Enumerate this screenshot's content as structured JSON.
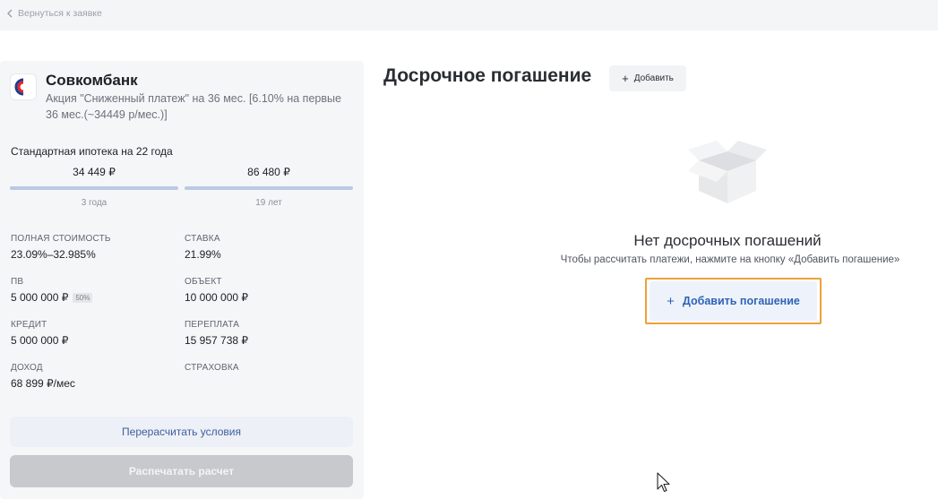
{
  "nav": {
    "back_label": "Вернуться к заявке"
  },
  "bank": {
    "name": "Совкомбанк",
    "promo": "Акция \"Сниженный платеж\" на 36 мес. [6.10% на первые 36 мес.(~34449 р/мес.)]",
    "brand_colors": {
      "red": "#e2242a",
      "blue": "#1f3b8c"
    }
  },
  "mortgage": {
    "title": "Стандартная ипотека на 22 года",
    "segments": [
      {
        "amount": "34 449 ₽",
        "duration": "3 года"
      },
      {
        "amount": "86 480 ₽",
        "duration": "19 лет"
      }
    ]
  },
  "details": {
    "full_cost": {
      "label": "ПОЛНАЯ СТОИМОСТЬ",
      "value": "23.09%–32.985%"
    },
    "rate": {
      "label": "СТАВКА",
      "value": "21.99%"
    },
    "down_payment": {
      "label": "ПВ",
      "value": "5 000 000 ₽",
      "badge": "50%"
    },
    "object": {
      "label": "ОБЪЕКТ",
      "value": "10 000 000 ₽"
    },
    "credit": {
      "label": "КРЕДИТ",
      "value": "5 000 000 ₽"
    },
    "overpayment": {
      "label": "ПЕРЕПЛАТА",
      "value": "15 957 738 ₽"
    },
    "income": {
      "label": "ДОХОД",
      "value": "68 899 ₽/мес"
    },
    "insurance": {
      "label": "СТРАХОВКА"
    }
  },
  "actions": {
    "recalc_label": "Перерасчитать условия",
    "print_label": "Распечатать расчет"
  },
  "early": {
    "title": "Досрочное погашение",
    "add_label": "Добавить",
    "empty_title": "Нет досрочных погашений",
    "empty_desc": "Чтобы рассчитать платежи, нажмите на кнопку «Добавить погашение»",
    "add_payment_label": "Добавить погашение",
    "highlight_color": "#eea039"
  },
  "icons": {
    "back": "chevron-left-icon",
    "plus": "plus-icon",
    "empty": "open-box-icon",
    "cursor": "mouse-pointer-icon"
  }
}
